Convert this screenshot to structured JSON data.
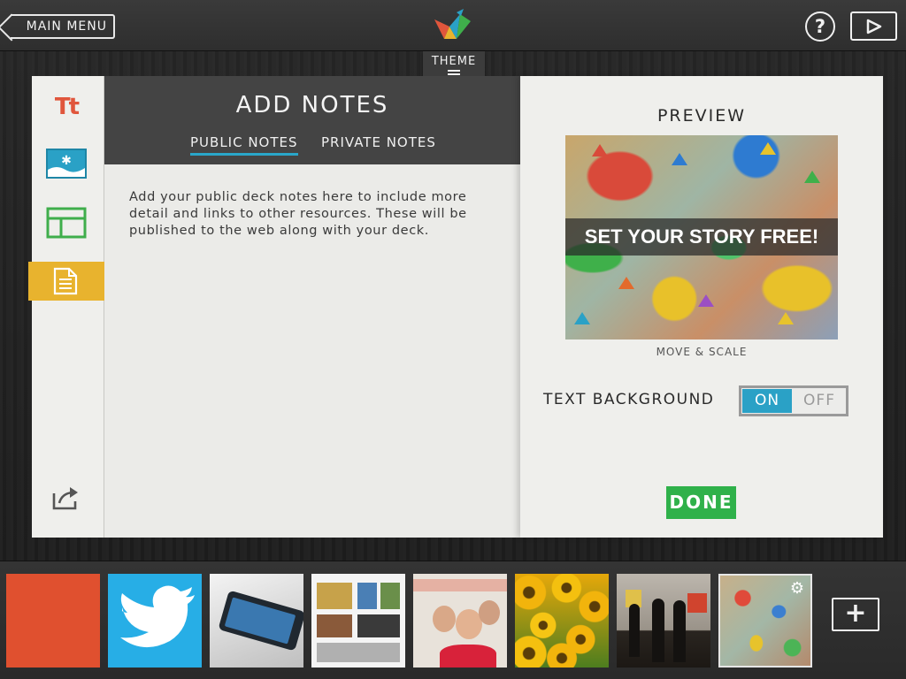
{
  "topbar": {
    "main_menu_label": "MAIN MENU",
    "help_label": "?",
    "theme_label": "THEME"
  },
  "sidebar": {
    "items": [
      {
        "name": "text",
        "icon": "text-tt-icon",
        "label": "Tt",
        "color": "#e0563c"
      },
      {
        "name": "image",
        "icon": "image-icon",
        "color": "#2aa1c6"
      },
      {
        "name": "layout",
        "icon": "layout-icon",
        "color": "#3fae4b"
      },
      {
        "name": "notes",
        "icon": "notes-icon",
        "color": "#e8b32e",
        "active": true
      },
      {
        "name": "share",
        "icon": "share-icon",
        "color": "#555555"
      }
    ]
  },
  "notes": {
    "title": "ADD NOTES",
    "tabs": [
      {
        "label": "PUBLIC NOTES",
        "active": true
      },
      {
        "label": "PRIVATE NOTES",
        "active": false
      }
    ],
    "placeholder": "Add your public deck notes here to include more detail and links to other resources. These will be published to the web along with your deck."
  },
  "preview": {
    "title": "PREVIEW",
    "caption": "SET YOUR STORY FREE!",
    "move_scale_label": "MOVE & SCALE",
    "text_background_label": "TEXT BACKGROUND",
    "toggle_on": "ON",
    "toggle_off": "OFF",
    "toggle_state": "ON",
    "done_label": "DONE"
  },
  "filmstrip": {
    "thumbnails": [
      {
        "name": "orange-slide"
      },
      {
        "name": "twitter-slide"
      },
      {
        "name": "phone-slide"
      },
      {
        "name": "website-slide"
      },
      {
        "name": "geekwire-photo-slide"
      },
      {
        "name": "sunflowers-slide"
      },
      {
        "name": "gallery-silhouettes-slide"
      },
      {
        "name": "paper-cranes-slide",
        "selected": true
      }
    ],
    "add_label": "+"
  },
  "colors": {
    "accent_blue": "#2aa1c6",
    "accent_green": "#2fb14a",
    "accent_yellow": "#e8b32e",
    "accent_orange": "#e0563c"
  }
}
